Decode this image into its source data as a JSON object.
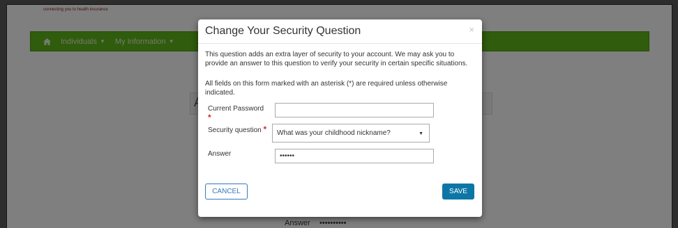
{
  "background": {
    "tagline": "connecting you to health insurance",
    "nav": {
      "items": [
        {
          "label": "Individuals",
          "caret": "▼"
        },
        {
          "label": "My Information",
          "caret": "▼"
        }
      ]
    },
    "partial_letter": "A",
    "answer_label": "Answer",
    "answer_value": "••••••••••"
  },
  "modal": {
    "title": "Change Your Security Question",
    "close": "×",
    "intro": "This question adds an extra layer of security to your account. We may ask you to provide an answer to this question to verify your security in certain specific situations.",
    "required_note": "All fields on this form marked with an asterisk (*) are required unless otherwise indicated.",
    "fields": {
      "current_password": {
        "label": "Current Password",
        "required_marker": "*",
        "value": ""
      },
      "security_question": {
        "label": "Security question",
        "required_marker": "*",
        "selected": "What was your childhood nickname?",
        "arrow": "▼"
      },
      "answer": {
        "label": "Answer",
        "value": "••••••"
      }
    },
    "buttons": {
      "cancel": "CANCEL",
      "save": "SAVE"
    }
  },
  "colors": {
    "nav_green": "#5fb91a",
    "save_blue": "#0c77a6",
    "cancel_border": "#337ab7",
    "required_red": "#c9302c"
  }
}
